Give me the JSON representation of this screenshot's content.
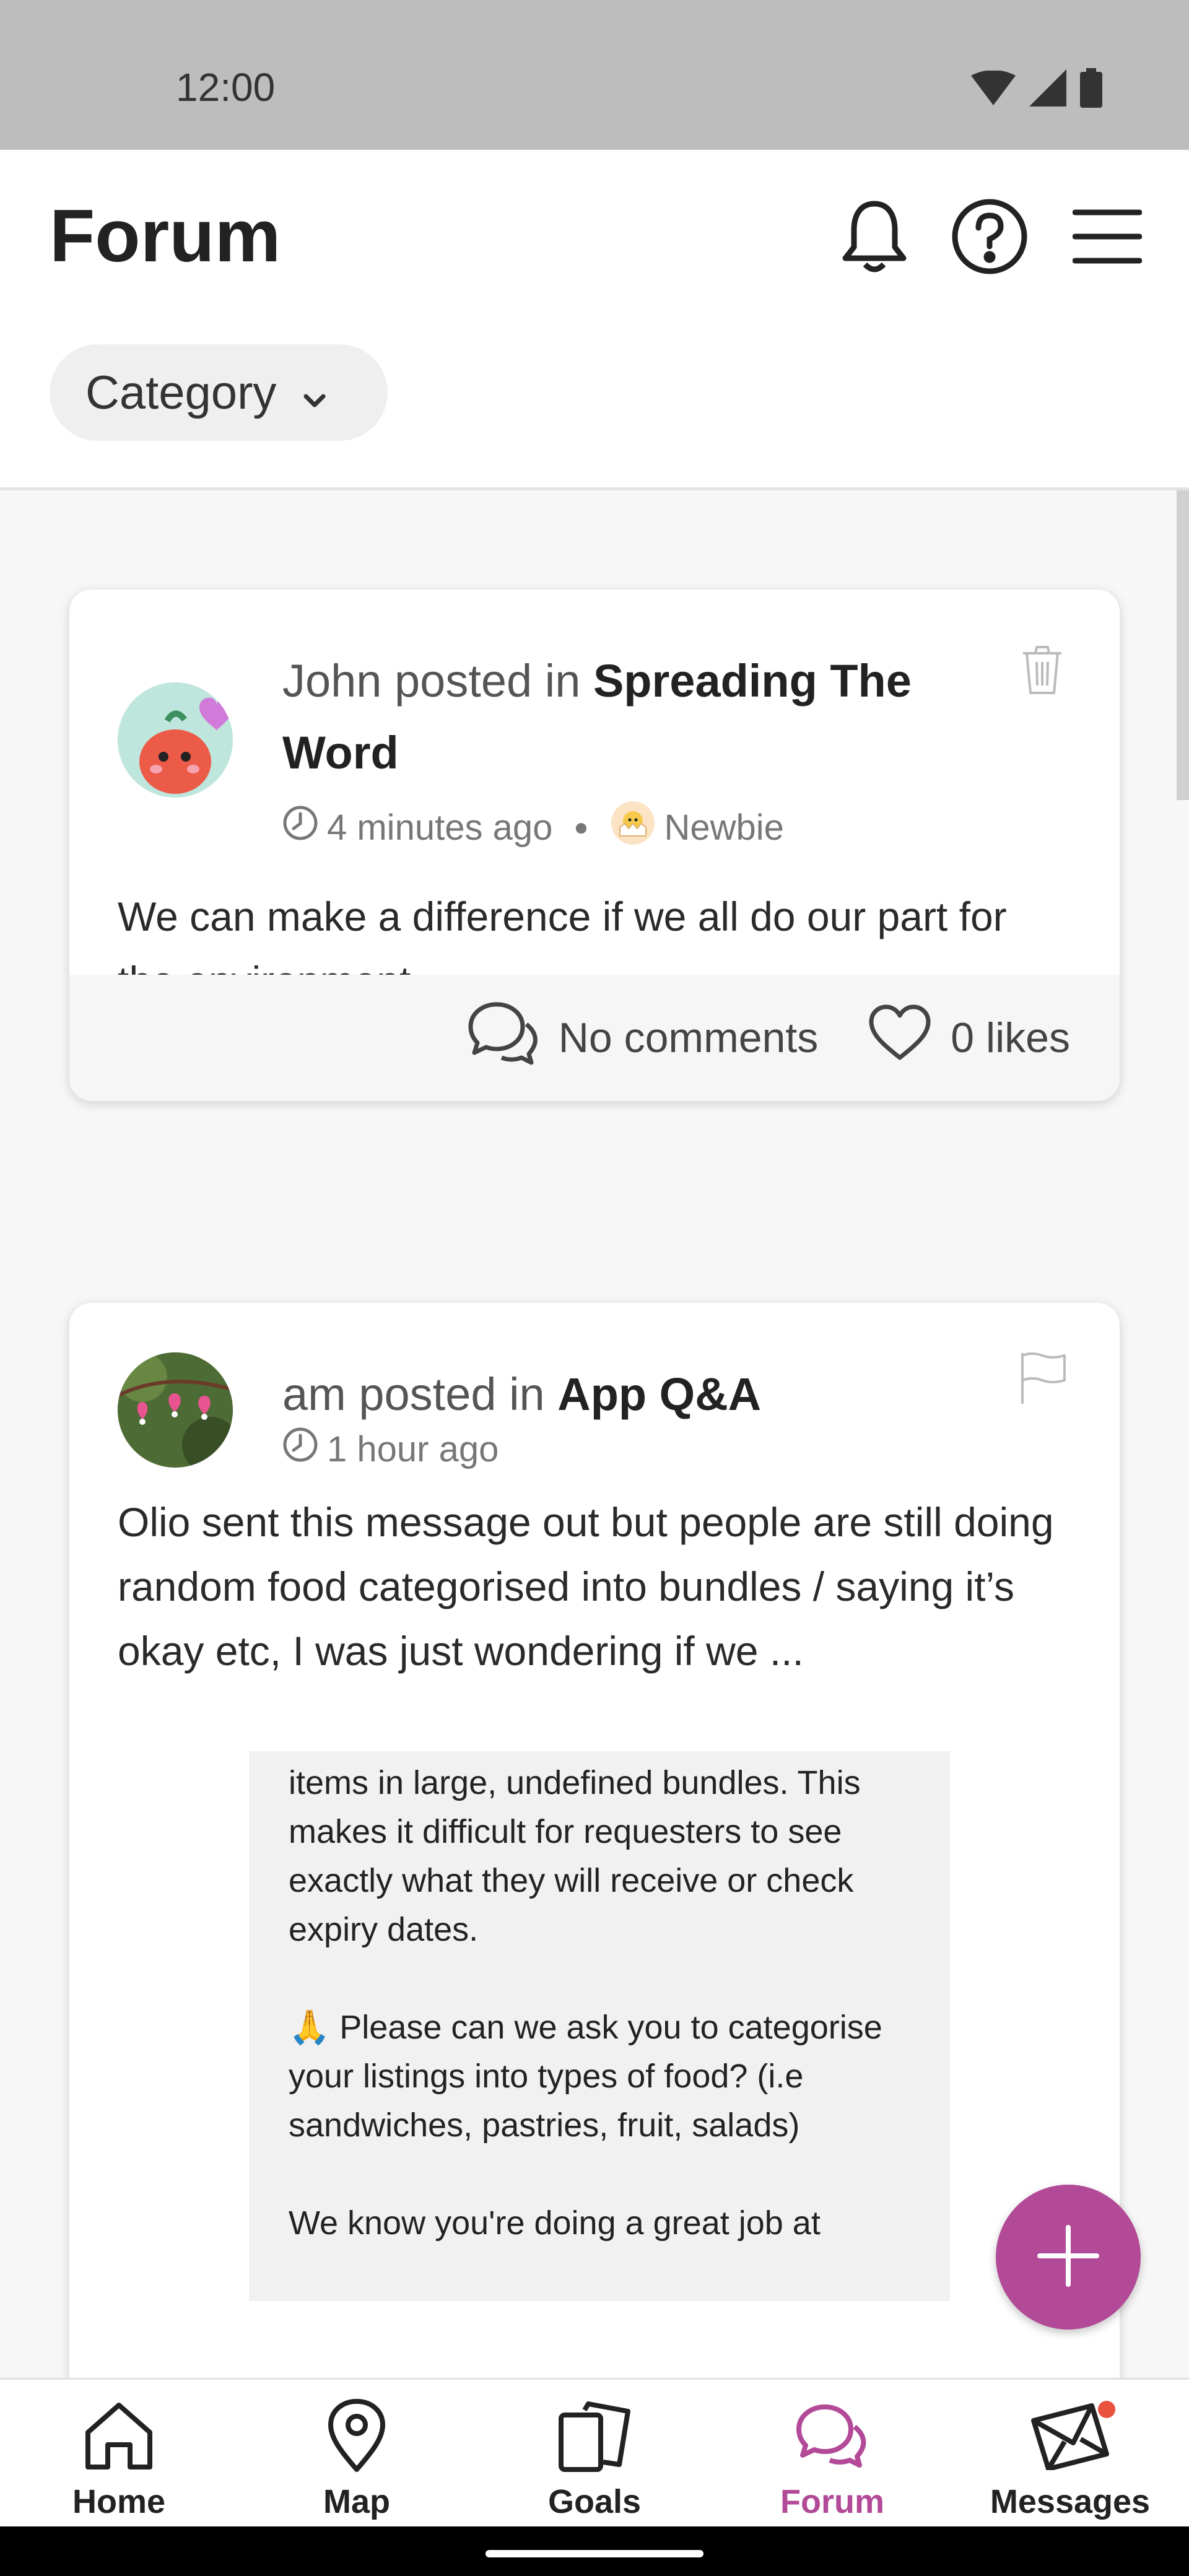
{
  "status_bar": {
    "time": "12:00"
  },
  "header": {
    "title": "Forum",
    "category_label": "Category"
  },
  "posts": [
    {
      "author": "John",
      "posted_in_text": "posted in",
      "category": "Spreading The Word",
      "time_ago": "4 minutes ago",
      "rank": "Newbie",
      "body": "We can make a difference if we all do our part for the environment.",
      "comments_label": "No comments",
      "likes_label": "0 likes",
      "action_icon": "trash-icon"
    },
    {
      "author": "am",
      "posted_in_text": "posted in",
      "category": "App Q&A",
      "time_ago": "1 hour ago",
      "body": "Olio sent this message out but people are still doing random food categorised into bundles / saying it’s okay etc, I was just wondering if we ...",
      "action_icon": "flag-icon",
      "image_text": {
        "p1": "items in large, undefined bundles. This makes it difficult for requesters to see exactly what they will receive or check expiry dates.",
        "p2": "Please can we ask you to categorise your listings into types of food? (i.e sandwiches, pastries, fruit, salads)",
        "p3": "We know you're doing a great job at"
      }
    }
  ],
  "bottom_nav": {
    "items": [
      {
        "label": "Home",
        "icon": "home-icon"
      },
      {
        "label": "Map",
        "icon": "map-pin-icon"
      },
      {
        "label": "Goals",
        "icon": "goals-icon"
      },
      {
        "label": "Forum",
        "icon": "forum-icon",
        "active": true
      },
      {
        "label": "Messages",
        "icon": "messages-icon",
        "badge": true
      }
    ]
  },
  "colors": {
    "accent": "#b24a97",
    "status_bar": "#bdbdbd",
    "badge": "#e8523f"
  }
}
